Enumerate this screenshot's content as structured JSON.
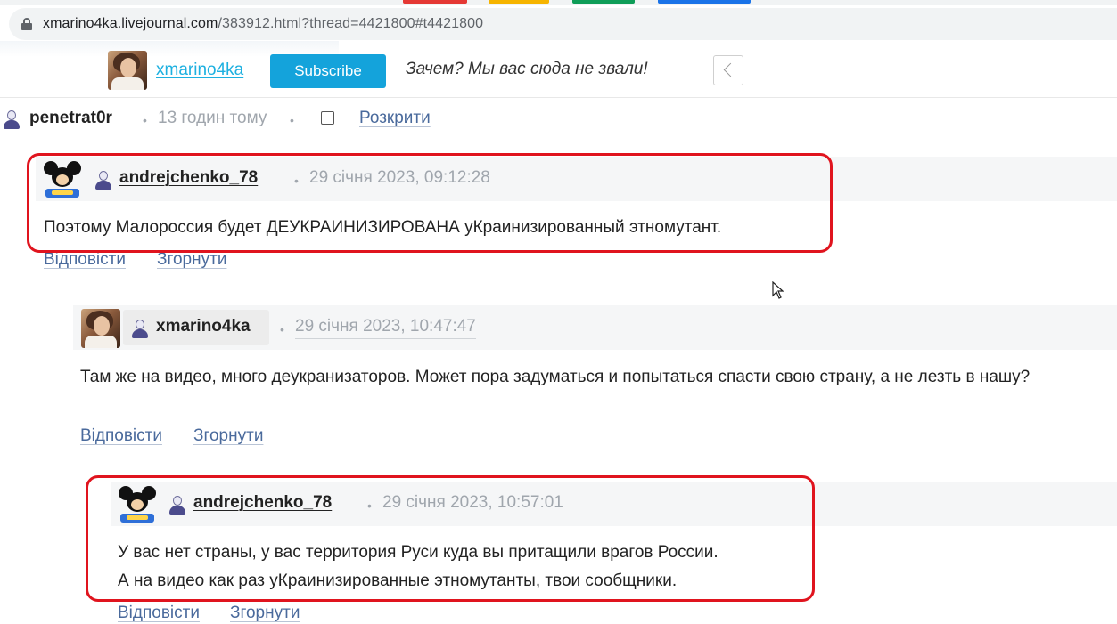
{
  "browser": {
    "url_host": "xmarino4ka.livejournal.com",
    "url_path": "/383912.html?thread=4421800#t4421800",
    "tab_colors": [
      "#e53935",
      "#f6b400",
      "#0f9d58",
      "#1a73e8"
    ]
  },
  "header": {
    "username": "xmarino4ka",
    "subscribe_label": "Subscribe",
    "tagline": "Зачем? Мы вас сюда не звали!"
  },
  "thread": {
    "parent": {
      "username": "penetrat0r",
      "time": "13 годин тому",
      "expand_label": "Розкрити"
    },
    "comments": [
      {
        "username": "andrejchenko_78",
        "timestamp": "29 січня 2023, 09:12:28",
        "lines": [
          "Поэтому Малороссия будет ДЕУКРАИНИЗИРОВАНА уКраинизированный этномутант."
        ],
        "reply_label": "Відповісти",
        "collapse_label": "Згорнути"
      },
      {
        "username": "xmarino4ka",
        "timestamp": "29 січня 2023, 10:47:47",
        "text": "Там же на видео, много деукранизаторов. Может пора задуматься и попытаться спасти свою страну, а не лезть в нашу?",
        "reply_label": "Відповісти",
        "collapse_label": "Згорнути"
      },
      {
        "username": "andrejchenko_78",
        "timestamp": "29 січня 2023, 10:57:01",
        "lines": [
          "У вас нет страны, у вас территория Руси куда вы притащили врагов России.",
          "А на видео как раз уКраинизированные этномутанты, твои сообщники."
        ],
        "reply_label": "Відповісти",
        "collapse_label": "Згорнути"
      }
    ]
  },
  "colors": {
    "highlight": "#e0141e",
    "subscribe_bg": "#14a3db",
    "link": "#4a6a9c",
    "meta": "#a0a6ad"
  }
}
